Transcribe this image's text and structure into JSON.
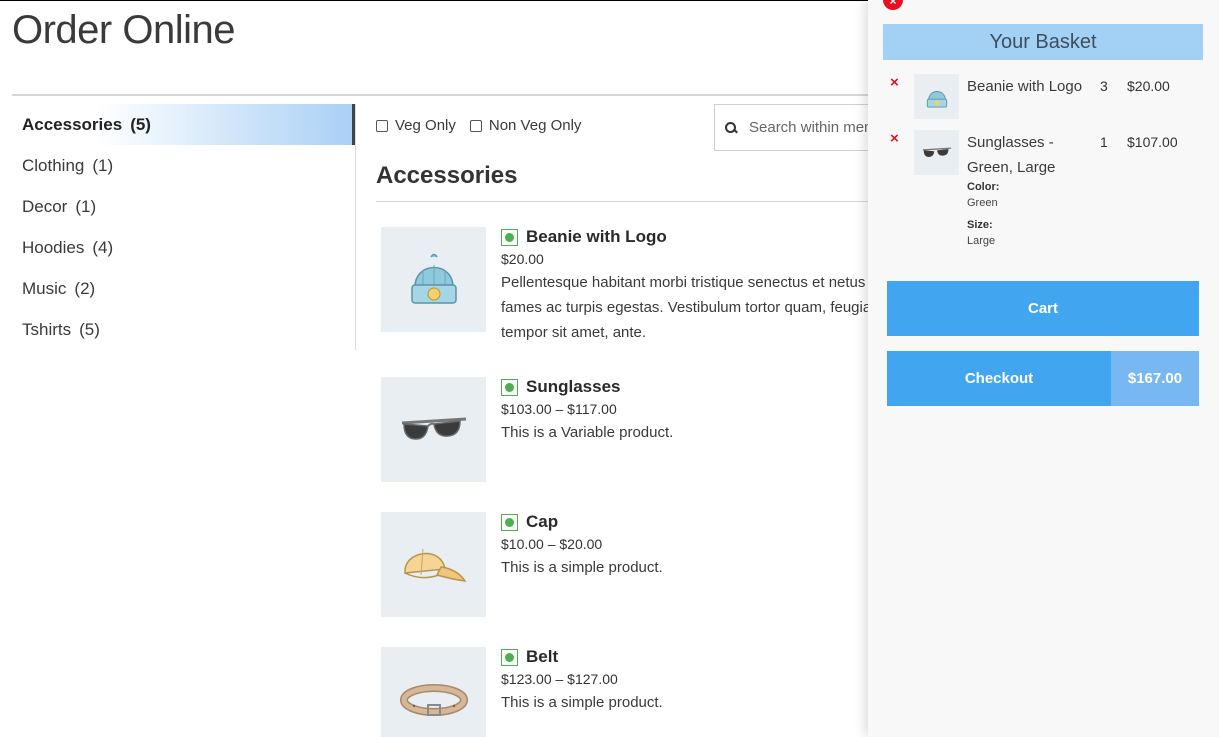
{
  "page": {
    "title": "Order Online"
  },
  "categories": [
    {
      "label": "Accessories",
      "count": "(5)",
      "active": true
    },
    {
      "label": "Clothing",
      "count": "(1)"
    },
    {
      "label": "Decor",
      "count": "(1)"
    },
    {
      "label": "Hoodies",
      "count": "(4)"
    },
    {
      "label": "Music",
      "count": "(2)"
    },
    {
      "label": "Tshirts",
      "count": "(5)"
    }
  ],
  "filters": {
    "veg_label": "Veg Only",
    "nonveg_label": "Non Veg Only"
  },
  "search": {
    "placeholder": "Search within menu"
  },
  "section": {
    "title": "Accessories"
  },
  "products": [
    {
      "name": "Beanie with Logo",
      "price": "$20.00",
      "desc": [
        "Pellentesque habitant morbi tristique senectus et netus",
        "fames ac turpis egestas. Vestibulum tortor quam, feugia",
        "tempor sit amet, ante."
      ],
      "icon": "beanie-icon"
    },
    {
      "name": "Sunglasses",
      "price": "$103.00 – $117.00",
      "desc": [
        "This is a Variable product."
      ],
      "icon": "sunglasses-icon"
    },
    {
      "name": "Cap",
      "price": "$10.00 – $20.00",
      "desc": [
        "This is a simple product."
      ],
      "icon": "cap-icon"
    },
    {
      "name": "Belt",
      "price": "$123.00 – $127.00",
      "desc": [
        "This is a simple product."
      ],
      "icon": "belt-icon"
    }
  ],
  "basket": {
    "title": "Your Basket",
    "close_glyph": "×",
    "remove_glyph": "×",
    "items": [
      {
        "name": "Beanie with Logo",
        "qty": "3",
        "price": "$20.00"
      },
      {
        "name_line1": "Sunglasses -",
        "name_line2": "Green, Large",
        "qty": "1",
        "price": "$107.00",
        "attrs": [
          {
            "label": "Color:",
            "value": "Green"
          },
          {
            "label": "Size:",
            "value": "Large"
          }
        ]
      }
    ],
    "cart_label": "Cart",
    "checkout_label": "Checkout",
    "total": "$167.00"
  },
  "colors": {
    "accent": "#42a5f0",
    "basket_header": "#a3d1f5",
    "veg": "#4caf50",
    "remove": "#e0101c"
  }
}
